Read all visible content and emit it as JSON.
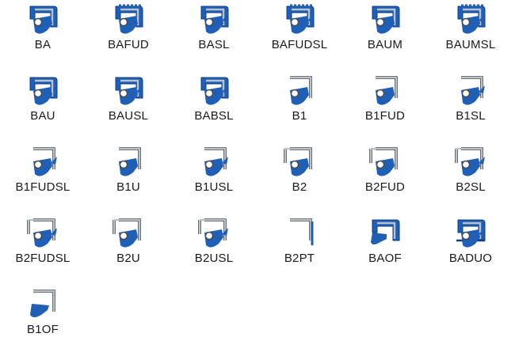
{
  "colors": {
    "blue": "#1f5fb5",
    "blue_dark": "#123f82",
    "steel": "#b8c2cc",
    "steel_dark": "#4a4a4a",
    "spring": "#ffffff"
  },
  "seals": [
    {
      "label": "BA",
      "case": "rubber",
      "dust_lip": false,
      "spring": true,
      "icon": "seal-rubber-covered-icon"
    },
    {
      "label": "BAFUD",
      "case": "rubber-ribbed",
      "dust_lip": false,
      "spring": true,
      "icon": "seal-rubber-covered-ribbed-icon"
    },
    {
      "label": "BASL",
      "case": "rubber",
      "dust_lip": true,
      "spring": true,
      "icon": "seal-rubber-covered-dust-lip-icon"
    },
    {
      "label": "BAFUDSL",
      "case": "rubber-ribbed",
      "dust_lip": true,
      "spring": true,
      "icon": "seal-rubber-covered-ribbed-dust-lip-icon"
    },
    {
      "label": "BAUM",
      "case": "rubber",
      "dust_lip": false,
      "spring": true,
      "icon": "seal-rubber-covered-icon"
    },
    {
      "label": "BAUMSL",
      "case": "rubber-ribbed",
      "dust_lip": true,
      "spring": true,
      "icon": "seal-rubber-covered-dust-lip-icon"
    },
    {
      "label": "BAU",
      "case": "rubber",
      "dust_lip": false,
      "spring": true,
      "icon": "seal-rubber-covered-icon"
    },
    {
      "label": "BAUSL",
      "case": "rubber",
      "dust_lip": true,
      "spring": true,
      "icon": "seal-rubber-covered-dust-lip-icon"
    },
    {
      "label": "BABSL",
      "case": "rubber-thin",
      "dust_lip": true,
      "spring": true,
      "icon": "seal-rubber-covered-dust-lip-icon"
    },
    {
      "label": "B1",
      "case": "metal",
      "dust_lip": false,
      "spring": true,
      "icon": "seal-metal-case-icon"
    },
    {
      "label": "B1FUD",
      "case": "metal",
      "dust_lip": false,
      "spring": true,
      "icon": "seal-metal-case-icon"
    },
    {
      "label": "B1SL",
      "case": "metal",
      "dust_lip": true,
      "spring": true,
      "icon": "seal-metal-case-dust-lip-icon"
    },
    {
      "label": "B1FUDSL",
      "case": "metal",
      "dust_lip": true,
      "spring": true,
      "icon": "seal-metal-case-dust-lip-icon"
    },
    {
      "label": "B1U",
      "case": "metal",
      "dust_lip": false,
      "spring": true,
      "icon": "seal-metal-case-icon"
    },
    {
      "label": "B1USL",
      "case": "metal",
      "dust_lip": true,
      "spring": true,
      "icon": "seal-metal-case-dust-lip-icon"
    },
    {
      "label": "B2",
      "case": "metal-double",
      "dust_lip": false,
      "spring": true,
      "icon": "seal-double-metal-case-icon"
    },
    {
      "label": "B2FUD",
      "case": "metal-double",
      "dust_lip": false,
      "spring": true,
      "icon": "seal-double-metal-case-icon"
    },
    {
      "label": "B2SL",
      "case": "metal-double",
      "dust_lip": true,
      "spring": true,
      "icon": "seal-double-metal-case-dust-lip-icon"
    },
    {
      "label": "B2FUDSL",
      "case": "metal-double",
      "dust_lip": true,
      "spring": true,
      "icon": "seal-double-metal-case-dust-lip-icon"
    },
    {
      "label": "B2U",
      "case": "metal-double",
      "dust_lip": false,
      "spring": true,
      "icon": "seal-double-metal-case-icon"
    },
    {
      "label": "B2USL",
      "case": "metal-double",
      "dust_lip": true,
      "spring": true,
      "icon": "seal-double-metal-case-dust-lip-icon"
    },
    {
      "label": "B2PT",
      "case": "metal-ptfe",
      "dust_lip": false,
      "spring": false,
      "icon": "seal-ptfe-lip-icon"
    },
    {
      "label": "BAOF",
      "case": "rubber-open",
      "dust_lip": false,
      "spring": false,
      "icon": "seal-rubber-no-spring-icon"
    },
    {
      "label": "BADUO",
      "case": "rubber-duo",
      "dust_lip": true,
      "spring": true,
      "icon": "seal-rubber-duo-icon"
    },
    {
      "label": "B1OF",
      "case": "metal-open",
      "dust_lip": false,
      "spring": false,
      "icon": "seal-metal-no-spring-icon"
    }
  ]
}
